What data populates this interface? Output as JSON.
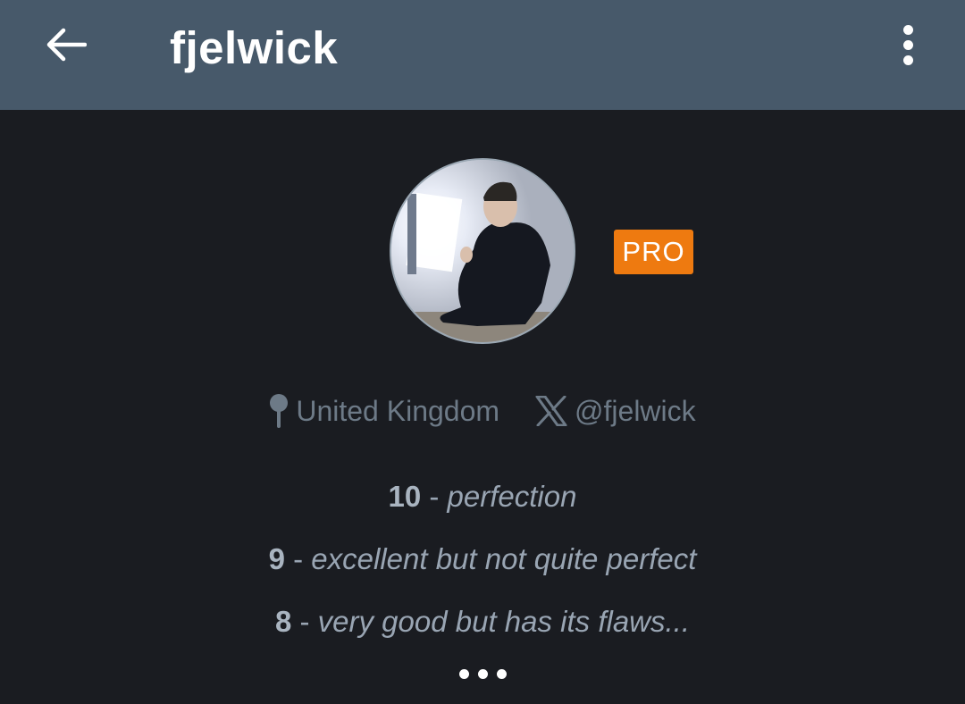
{
  "header": {
    "title": "fjelwick",
    "back_icon": "arrow-left-icon",
    "more_icon": "more-vert-icon",
    "background_color": "#47596a"
  },
  "profile": {
    "avatar_description": "profile-photo",
    "badge": "PRO",
    "badge_color": "#ee7a10",
    "location": "United Kingdom",
    "location_icon": "map-pin-icon",
    "social_handle": "@fjelwick",
    "social_icon": "x-logo-icon"
  },
  "ratings": [
    {
      "score": "10",
      "separator": " - ",
      "description": "perfection"
    },
    {
      "score": "9",
      "separator": " - ",
      "description": "excellent but not quite perfect"
    },
    {
      "score": "8",
      "separator": " - ",
      "description": "very good but has its flaws..."
    }
  ],
  "expand_icon": "ellipsis-icon"
}
